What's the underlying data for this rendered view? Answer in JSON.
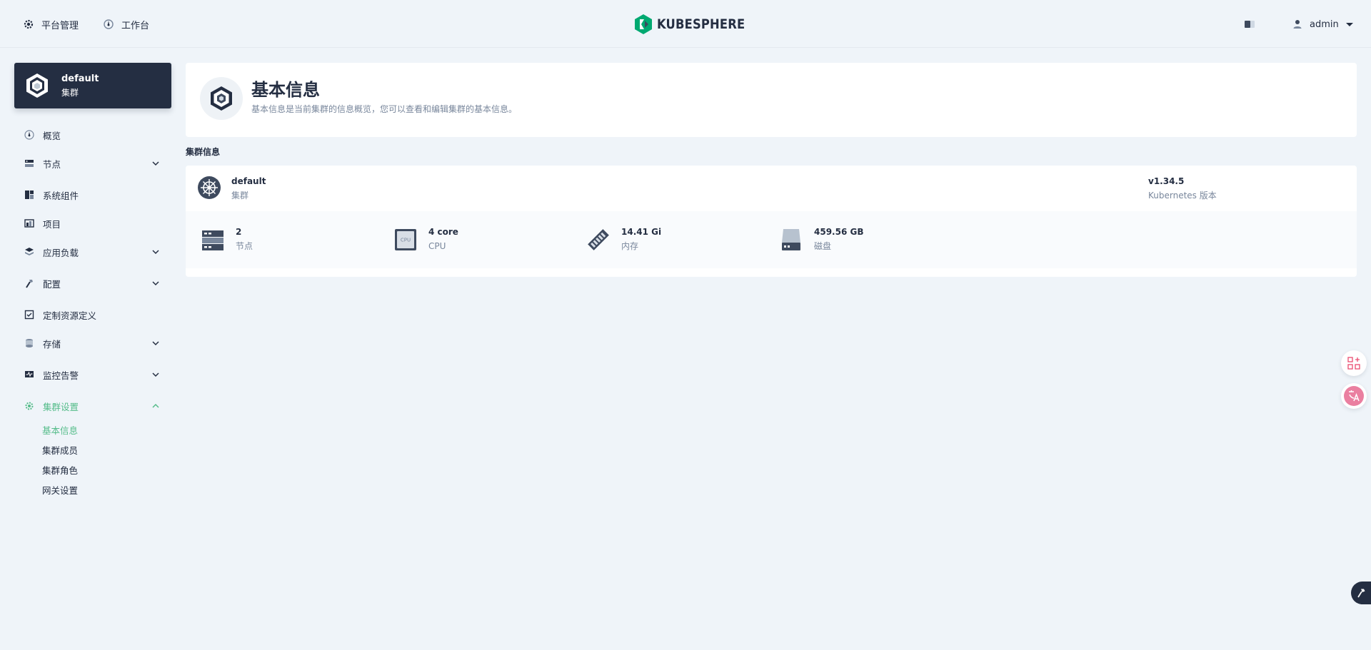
{
  "topbar": {
    "platform_label": "平台管理",
    "workbench_label": "工作台",
    "brand": "KUBESPHERE",
    "user": "admin"
  },
  "sidebar": {
    "cluster_name": "default",
    "cluster_type": "集群",
    "items": [
      {
        "label": "概览",
        "icon": "dashboard-icon",
        "expandable": false
      },
      {
        "label": "节点",
        "icon": "nodes-icon",
        "expandable": true
      },
      {
        "label": "系统组件",
        "icon": "components-icon",
        "expandable": false
      },
      {
        "label": "项目",
        "icon": "project-icon",
        "expandable": false
      },
      {
        "label": "应用负载",
        "icon": "workload-icon",
        "expandable": true
      },
      {
        "label": "配置",
        "icon": "config-icon",
        "expandable": true
      },
      {
        "label": "定制资源定义",
        "icon": "crd-icon",
        "expandable": false
      },
      {
        "label": "存储",
        "icon": "storage-icon",
        "expandable": true
      },
      {
        "label": "监控告警",
        "icon": "monitoring-icon",
        "expandable": true
      },
      {
        "label": "集群设置",
        "icon": "settings-icon",
        "expandable": true,
        "expanded": true,
        "active": true
      }
    ],
    "sub_items": [
      {
        "label": "基本信息",
        "active": true
      },
      {
        "label": "集群成员"
      },
      {
        "label": "集群角色"
      },
      {
        "label": "网关设置"
      }
    ]
  },
  "header": {
    "title": "基本信息",
    "description": "基本信息是当前集群的信息概览，您可以查看和编辑集群的基本信息。"
  },
  "cluster_info": {
    "section_title": "集群信息",
    "name": "default",
    "type": "集群",
    "version": "v1.34.5",
    "version_label": "Kubernetes 版本",
    "stats": [
      {
        "value": "2",
        "label": "节点",
        "icon": "server-icon"
      },
      {
        "value": "4 core",
        "label": "CPU",
        "icon": "cpu-icon",
        "chip_text": "CPU"
      },
      {
        "value": "14.41 Gi",
        "label": "内存",
        "icon": "memory-icon"
      },
      {
        "value": "459.56 GB",
        "label": "磁盘",
        "icon": "disk-icon"
      }
    ]
  },
  "colors": {
    "accent": "#55bc8a",
    "dark": "#242e42",
    "muted": "#79879c",
    "background": "#eff4f9"
  }
}
